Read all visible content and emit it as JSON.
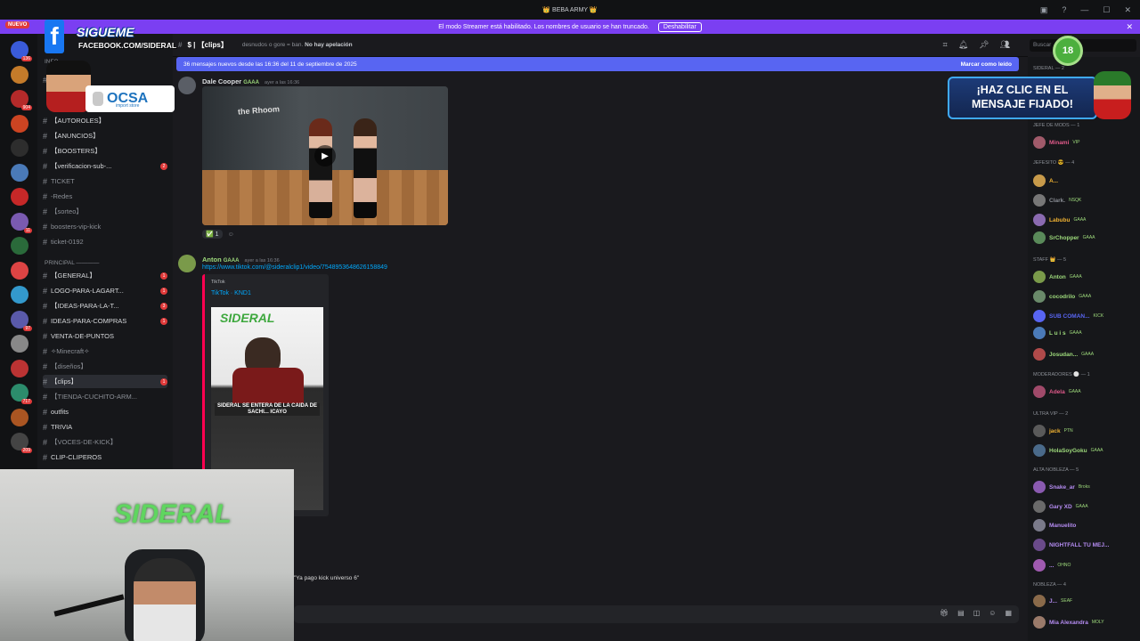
{
  "titlebar": {
    "title": "👑 BEBA ARMY 👑"
  },
  "streamer_banner": {
    "text": "El modo Streamer está habilitado. Los nombres de usuario se han truncado.",
    "button": "Deshabilitar",
    "badge": "NUEVO"
  },
  "overlay": {
    "facebook_line1": "SIGUEME",
    "facebook_line2": "FACEBOOK.COM/SIDERAL",
    "sponsor_name": "OCSA",
    "sponsor_sub": "import store",
    "clic_line1": "¡HAZ CLIC EN EL",
    "clic_line2": "MENSAJE FIJADO!",
    "age_badge": "18"
  },
  "servers": [
    {
      "badge": "136"
    },
    {
      "badge": ""
    },
    {
      "badge": "904"
    },
    {
      "badge": ""
    },
    {
      "badge": ""
    },
    {
      "badge": ""
    },
    {
      "badge": ""
    },
    {
      "badge": "11"
    },
    {
      "badge": ""
    },
    {
      "badge": ""
    },
    {
      "badge": ""
    },
    {
      "badge": "97"
    },
    {
      "badge": ""
    },
    {
      "badge": ""
    },
    {
      "badge": "717"
    },
    {
      "badge": ""
    },
    {
      "badge": "209"
    }
  ],
  "channels": {
    "cat_info": "INFO",
    "cat_principal": "PRINCIPAL ————",
    "items": [
      {
        "name": "【REGLAS】",
        "badge": ""
      },
      {
        "name": "【AUTOROLES】",
        "badge": ""
      },
      {
        "name": "【ANUNCIOS】",
        "badge": ""
      },
      {
        "name": "【BOOSTERS】",
        "badge": ""
      },
      {
        "name": "【verificacion-sub-...",
        "badge": "2"
      },
      {
        "name": "TICKET",
        "badge": ""
      },
      {
        "name": "-Redes",
        "badge": ""
      },
      {
        "name": "【sorteo】",
        "badge": ""
      },
      {
        "name": "boosters-vip-kick",
        "badge": ""
      },
      {
        "name": "ticket-0192",
        "badge": ""
      },
      {
        "name": "【GENERAL】",
        "badge": "1"
      },
      {
        "name": "LOGO-PARA-LAGART...",
        "badge": "1"
      },
      {
        "name": "【IDEAS-PARA-LA-T...",
        "badge": "3"
      },
      {
        "name": "IDEAS-PARA-COMPRAS",
        "badge": "1"
      },
      {
        "name": "VENTA-DE-PUNTOS",
        "badge": ""
      },
      {
        "name": "✧Minecraft✧",
        "badge": ""
      },
      {
        "name": "【diseños】",
        "badge": ""
      },
      {
        "name": "【clips】",
        "badge": "1"
      },
      {
        "name": "【TIENDA-CUCHITO-ARM...",
        "badge": ""
      },
      {
        "name": "outfits",
        "badge": ""
      },
      {
        "name": "TRIVIA",
        "badge": ""
      },
      {
        "name": "【VOCES-DE-KICK】",
        "badge": ""
      },
      {
        "name": "CLIP-CLIPEROS",
        "badge": ""
      }
    ]
  },
  "header": {
    "channel": "$ | 【clips】",
    "topic": "desnudos o gore = ban.",
    "topic_bold": "No hay apelación",
    "search_placeholder": "Buscar"
  },
  "new_messages": {
    "text": "36 mensajes nuevos desde las 16:36 del 11 de septiembre de 2025",
    "action": "Marcar como leído"
  },
  "messages": [
    {
      "author": "Dale Cooper",
      "tag": "GAAA",
      "time": "ayer a las 16:36",
      "video_label": "the Rhoom",
      "reaction_count": "1"
    },
    {
      "author": "Anton",
      "tag": "GAAA",
      "time": "ayer a las 16:36",
      "link": "https://www.tiktok.com/@sideralclip1/video/7548953648626158849",
      "embed_provider": "TikTok",
      "embed_title": "TikTok · KND1",
      "embed_caption": "SIDERAL SE ENTERA DE LA CAIDA DE SACHI... ICAYO",
      "embed_logo": "SIDERAL"
    }
  ],
  "webcam": {
    "logo": "SIDERAL",
    "quote": "\"Ya pago kick universo 6\""
  },
  "members": {
    "categories": [
      {
        "label": "SIDERAL — 2"
      },
      {
        "label": "JEFE DE MODS — 1"
      },
      {
        "label": "JEFESITO 😎 — 4"
      },
      {
        "label": "STAFF 👑 — 5"
      },
      {
        "label": "MODERADORES ⚪ — 1"
      },
      {
        "label": "ULTRA VIP — 2"
      },
      {
        "label": "ALTA NOBLEZA — 5"
      },
      {
        "label": "NOBLEZA — 4"
      }
    ],
    "list": [
      {
        "name": "Minami",
        "badge": "VIP",
        "color": "#e05a8a"
      },
      {
        "name": "A...",
        "badge": "",
        "color": "#f0b232"
      },
      {
        "name": "Clark.",
        "badge": "NSQK",
        "color": "#8a8e95"
      },
      {
        "name": "Labubu",
        "badge": "GAAA",
        "color": "#f0b232"
      },
      {
        "name": "SrChopper",
        "badge": "GAAA",
        "color": "#9dd97b"
      },
      {
        "name": "Anton",
        "badge": "GAAA",
        "color": "#9dd97b"
      },
      {
        "name": "cocodrilo",
        "badge": "GAAA",
        "color": "#9dd97b"
      },
      {
        "name": "SUB COMAN...",
        "badge": "KICK",
        "color": "#5865f2"
      },
      {
        "name": "L u i s",
        "badge": "GAAA",
        "color": "#9dd97b"
      },
      {
        "name": "Josudan...",
        "badge": "GAAA",
        "color": "#9dd97b"
      },
      {
        "name": "Adela",
        "badge": "GAAA",
        "color": "#e05a8a"
      },
      {
        "name": "jack",
        "badge": "PTN",
        "color": "#f0b232"
      },
      {
        "name": "HolaSoyGoku",
        "badge": "GAAA",
        "color": "#9dd97b"
      },
      {
        "name": "Snake_ar",
        "badge": "Broks",
        "color": "#b58cf2"
      },
      {
        "name": "Gary XD",
        "badge": "GAAA",
        "color": "#b58cf2"
      },
      {
        "name": "Manuelito",
        "badge": "",
        "color": "#b58cf2"
      },
      {
        "name": "NIGHTFALL TU MEJ...",
        "badge": "",
        "color": "#b58cf2"
      },
      {
        "name": "...",
        "badge": "OHNO",
        "color": "#b58cf2"
      },
      {
        "name": "J...",
        "badge": "SEAF",
        "color": "#b58cf2"
      },
      {
        "name": "Mia Alexandra",
        "badge": "MOLY",
        "color": "#b58cf2"
      }
    ]
  }
}
